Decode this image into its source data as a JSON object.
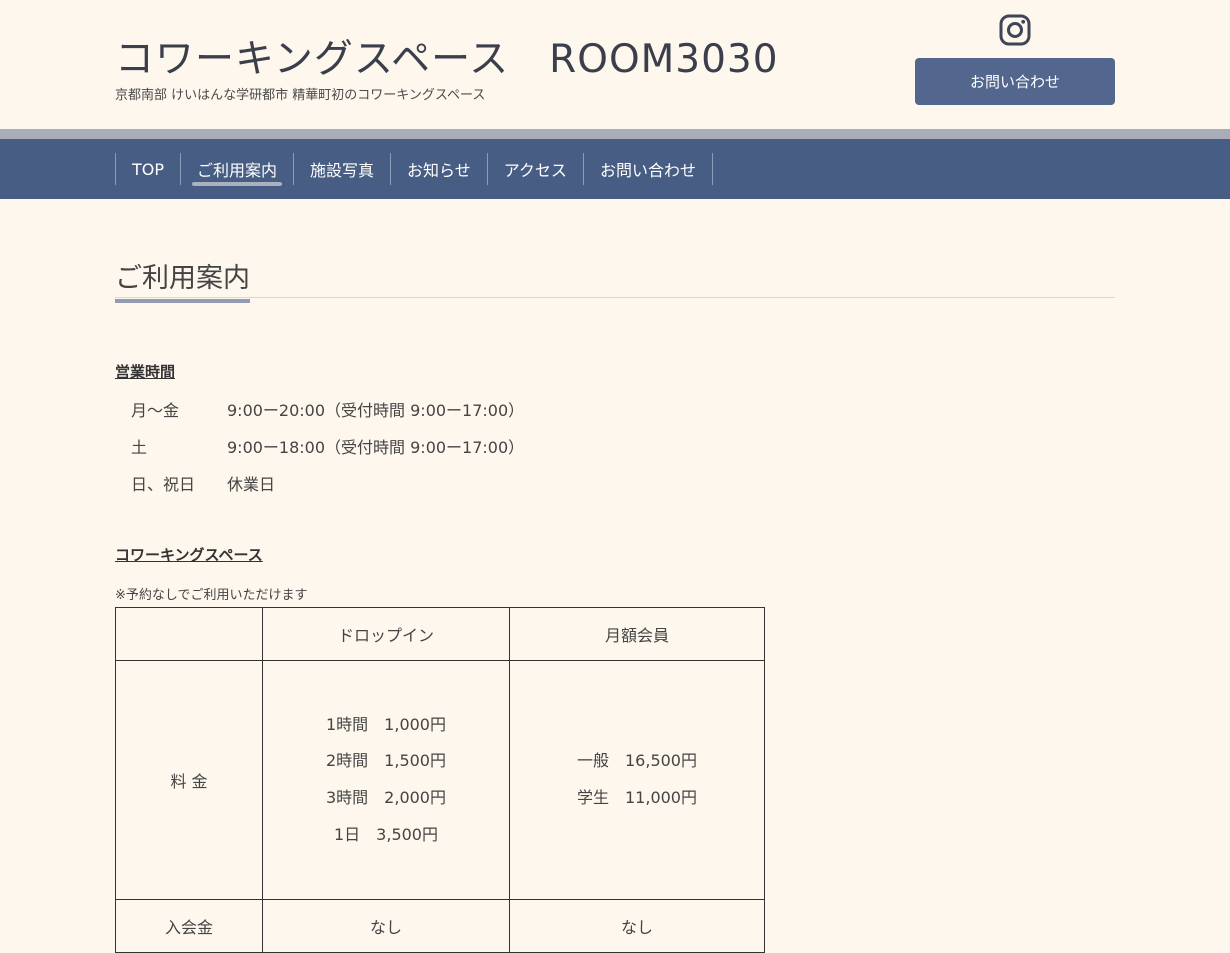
{
  "header": {
    "title": "コワーキングスペース　ROOM3030",
    "subtitle": "京都南部 けいはんな学研都市 精華町初のコワーキングスペース",
    "contact_label": "お問い合わせ",
    "social_icon": "instagram-icon"
  },
  "nav": {
    "items": [
      {
        "label": "TOP"
      },
      {
        "label": "ご利用案内"
      },
      {
        "label": "施設写真"
      },
      {
        "label": "お知らせ"
      },
      {
        "label": "アクセス"
      },
      {
        "label": "お問い合わせ"
      }
    ],
    "active": "ご利用案内"
  },
  "main": {
    "heading": "ご利用案内",
    "hours_title": "営業時間",
    "hours": [
      {
        "day": "月〜金",
        "time": "9:00ー20:00（受付時間 9:00ー17:00）"
      },
      {
        "day": "土",
        "time": "9:00ー18:00（受付時間 9:00ー17:00）"
      },
      {
        "day": "日、祝日",
        "time": "休業日"
      }
    ],
    "coworking_title": "コワーキングスペース",
    "note": "※予約なしでご利用いただけます",
    "table": {
      "headers": [
        "",
        "ドロップイン",
        "月額会員"
      ],
      "fee_label": "料 金",
      "dropin_fees": [
        "1時間　1,000円",
        "2時間　1,500円",
        "3時間　2,000円",
        "1日　3,500円"
      ],
      "member_fees": [
        "一般　16,500円",
        "学生　11,000円"
      ],
      "entry_label": "入会金",
      "entry_dropin": "なし",
      "entry_member": "なし"
    }
  },
  "colors": {
    "background": "#fdf7ed",
    "nav": "#475d83",
    "button": "#52668e",
    "nav_accent": "#a9adb8"
  }
}
